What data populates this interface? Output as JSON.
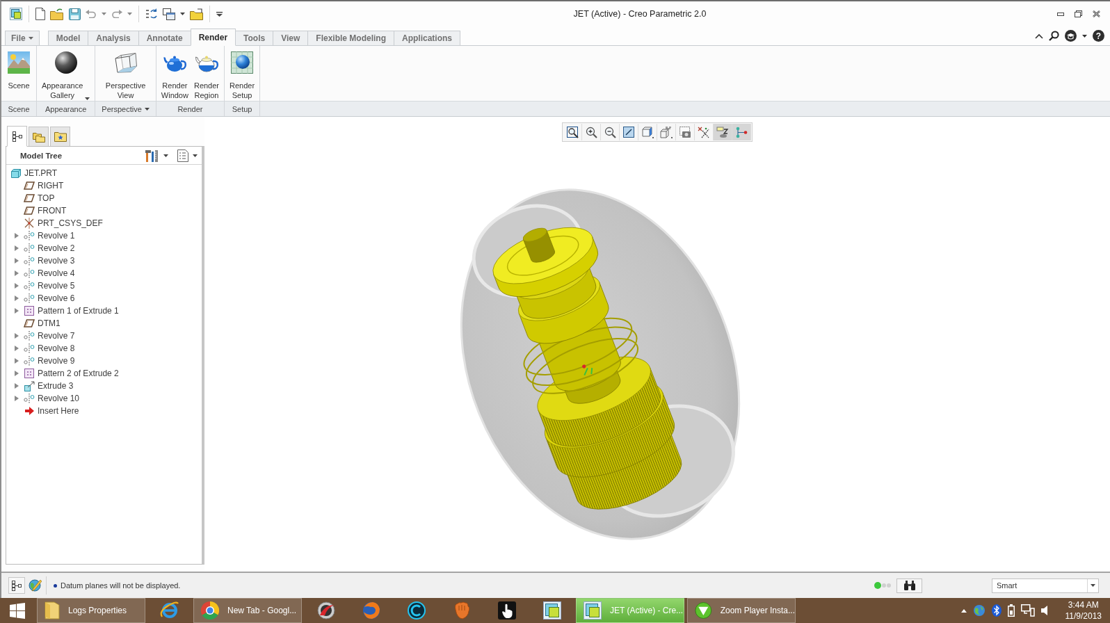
{
  "window": {
    "title": "JET (Active) - Creo Parametric 2.0",
    "help": "?"
  },
  "ribbon_tabs": [
    {
      "label": "File",
      "kind": "menu",
      "selected": false
    },
    {
      "label": "Model",
      "kind": "tab",
      "selected": false
    },
    {
      "label": "Analysis",
      "kind": "tab",
      "selected": false
    },
    {
      "label": "Annotate",
      "kind": "tab",
      "selected": false
    },
    {
      "label": "Render",
      "kind": "tab",
      "selected": true
    },
    {
      "label": "Tools",
      "kind": "tab",
      "selected": false
    },
    {
      "label": "View",
      "kind": "tab",
      "selected": false
    },
    {
      "label": "Flexible Modeling",
      "kind": "tab",
      "selected": false
    },
    {
      "label": "Applications",
      "kind": "tab",
      "selected": false
    }
  ],
  "ribbon_groups": [
    {
      "label": "Scene",
      "dropdown": false,
      "buttons": [
        {
          "label": "Scene",
          "kind": "scene",
          "dropdown": false
        }
      ]
    },
    {
      "label": "Appearance",
      "dropdown": false,
      "buttons": [
        {
          "label": "Appearance Gallery",
          "kind": "appearance",
          "dropdown": true
        }
      ]
    },
    {
      "label": "Perspective",
      "dropdown": true,
      "buttons": [
        {
          "label": "Perspective View",
          "kind": "perspective",
          "dropdown": false
        }
      ]
    },
    {
      "label": "Render",
      "dropdown": false,
      "buttons": [
        {
          "label": "Render Window",
          "kind": "render-window",
          "dropdown": false
        },
        {
          "label": "Render Region",
          "kind": "render-region",
          "dropdown": false
        }
      ]
    },
    {
      "label": "Setup",
      "dropdown": false,
      "buttons": [
        {
          "label": "Render Setup",
          "kind": "render-setup",
          "dropdown": false
        }
      ]
    }
  ],
  "navigator_tabs": [
    {
      "kind": "tree",
      "selected": true
    },
    {
      "kind": "folders",
      "selected": false
    },
    {
      "kind": "favorites",
      "selected": false
    }
  ],
  "model_tree": {
    "title": "Model Tree",
    "root": {
      "label": "JET.PRT",
      "kind": "part",
      "children": [
        {
          "label": "RIGHT",
          "kind": "plane",
          "expandable": false
        },
        {
          "label": "TOP",
          "kind": "plane",
          "expandable": false
        },
        {
          "label": "FRONT",
          "kind": "plane",
          "expandable": false
        },
        {
          "label": "PRT_CSYS_DEF",
          "kind": "csys",
          "expandable": false
        },
        {
          "label": "Revolve 1",
          "kind": "revolve",
          "expandable": true
        },
        {
          "label": "Revolve 2",
          "kind": "revolve",
          "expandable": true
        },
        {
          "label": "Revolve 3",
          "kind": "revolve",
          "expandable": true
        },
        {
          "label": "Revolve 4",
          "kind": "revolve",
          "expandable": true
        },
        {
          "label": "Revolve 5",
          "kind": "revolve",
          "expandable": true
        },
        {
          "label": "Revolve 6",
          "kind": "revolve",
          "expandable": true
        },
        {
          "label": "Pattern 1 of Extrude 1",
          "kind": "pattern",
          "expandable": true
        },
        {
          "label": "DTM1",
          "kind": "plane",
          "expandable": false
        },
        {
          "label": "Revolve 7",
          "kind": "revolve",
          "expandable": true
        },
        {
          "label": "Revolve 8",
          "kind": "revolve",
          "expandable": true
        },
        {
          "label": "Revolve 9",
          "kind": "revolve",
          "expandable": true
        },
        {
          "label": "Pattern 2 of Extrude 2",
          "kind": "pattern",
          "expandable": true
        },
        {
          "label": "Extrude 3",
          "kind": "extrude",
          "expandable": true
        },
        {
          "label": "Revolve 10",
          "kind": "revolve",
          "expandable": true
        },
        {
          "label": "Insert Here",
          "kind": "insert",
          "expandable": false
        }
      ]
    }
  },
  "view_toolbar": [
    {
      "kind": "refit",
      "pressed": false
    },
    {
      "kind": "zoom-in",
      "pressed": false
    },
    {
      "kind": "zoom-out",
      "pressed": false
    },
    {
      "kind": "repaint",
      "pressed": false
    },
    {
      "kind": "display-style",
      "pressed": false
    },
    {
      "kind": "orientation",
      "pressed": false
    },
    {
      "kind": "view-manager",
      "pressed": false
    },
    {
      "kind": "datum-display",
      "pressed": false
    },
    {
      "kind": "annotation-display",
      "pressed": true
    },
    {
      "kind": "spin-center",
      "pressed": true
    }
  ],
  "status_bar": {
    "message": "Datum planes will not be displayed.",
    "selection_filter": {
      "value": "Smart"
    }
  },
  "taskbar": {
    "items": [
      {
        "kind": "folder",
        "label": "Logs Properties",
        "selected": false
      },
      {
        "kind": "browser-e",
        "selected": false
      },
      {
        "kind": "browser-circle",
        "label": "New Tab - Googl...",
        "selected": false
      },
      {
        "kind": "disc",
        "selected": false
      },
      {
        "kind": "fox",
        "selected": false
      },
      {
        "kind": "ring",
        "selected": false
      },
      {
        "kind": "glove",
        "selected": false
      },
      {
        "kind": "hand",
        "selected": false
      },
      {
        "kind": "app-window",
        "selected": false
      },
      {
        "kind": "app-window",
        "label": "JET (Active) - Cre...",
        "selected": true
      },
      {
        "kind": "play",
        "label": "Zoom Player Insta...",
        "selected": false
      }
    ],
    "time": "3:44 AM",
    "date": "11/9/2013"
  }
}
